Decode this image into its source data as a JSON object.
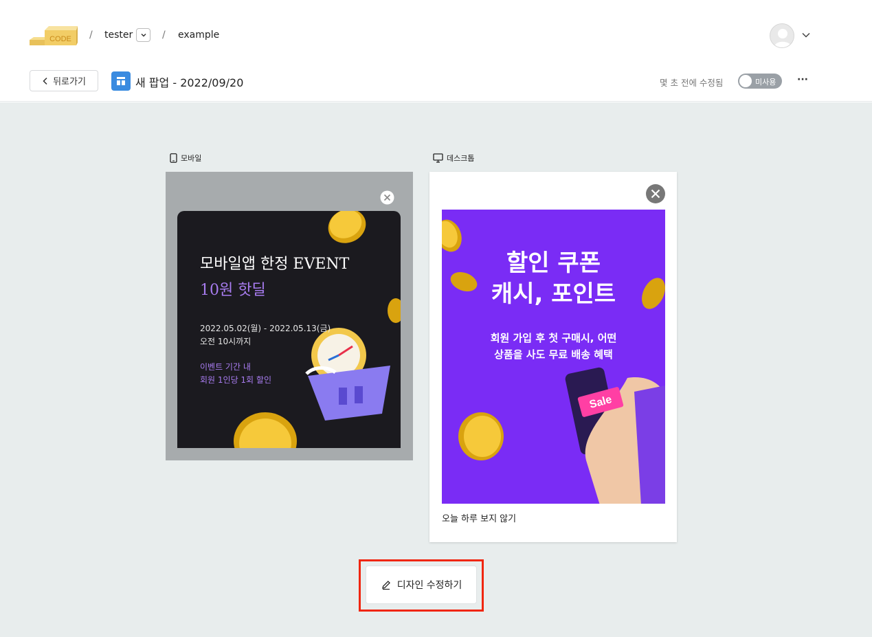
{
  "header": {
    "logo_text": "CODE",
    "breadcrumb": {
      "separator": "/",
      "workspace": "tester",
      "project": "example"
    },
    "back_label": "뒤로가기",
    "page_title": "새 팝업 - 2022/09/20",
    "modified_text": "몇 초 전에 수정됨",
    "toggle_label": "미사용",
    "more_label": "···"
  },
  "previews": {
    "mobile": {
      "label": "모바일",
      "title_line1": "모바일앱 한정 EVENT",
      "title_line2": "10원 핫딜",
      "date_line1": "2022.05.02(월) - 2022.05.13(금)",
      "date_line2": "오전 10시까지",
      "event_line1": "이벤트 기간 내",
      "event_line2": "회원 1인당 1회 할인"
    },
    "desktop": {
      "label": "데스크톱",
      "title_line1": "할인 쿠폰",
      "title_line2": "캐시, 포인트",
      "sub_line1": "회원 가입 후 첫 구매시, 어떤",
      "sub_line2": "상품을 사도 무료 배송 혜택",
      "sale_tag": "Sale",
      "dont_show_label": "오늘 하루 보지 않기"
    }
  },
  "actions": {
    "edit_design_label": "디자인 수정하기"
  },
  "colors": {
    "accent_blue": "#3a8be0",
    "highlight_red": "#f0260f",
    "purple": "#7a2cf5",
    "canvas_bg": "#e8eded"
  }
}
